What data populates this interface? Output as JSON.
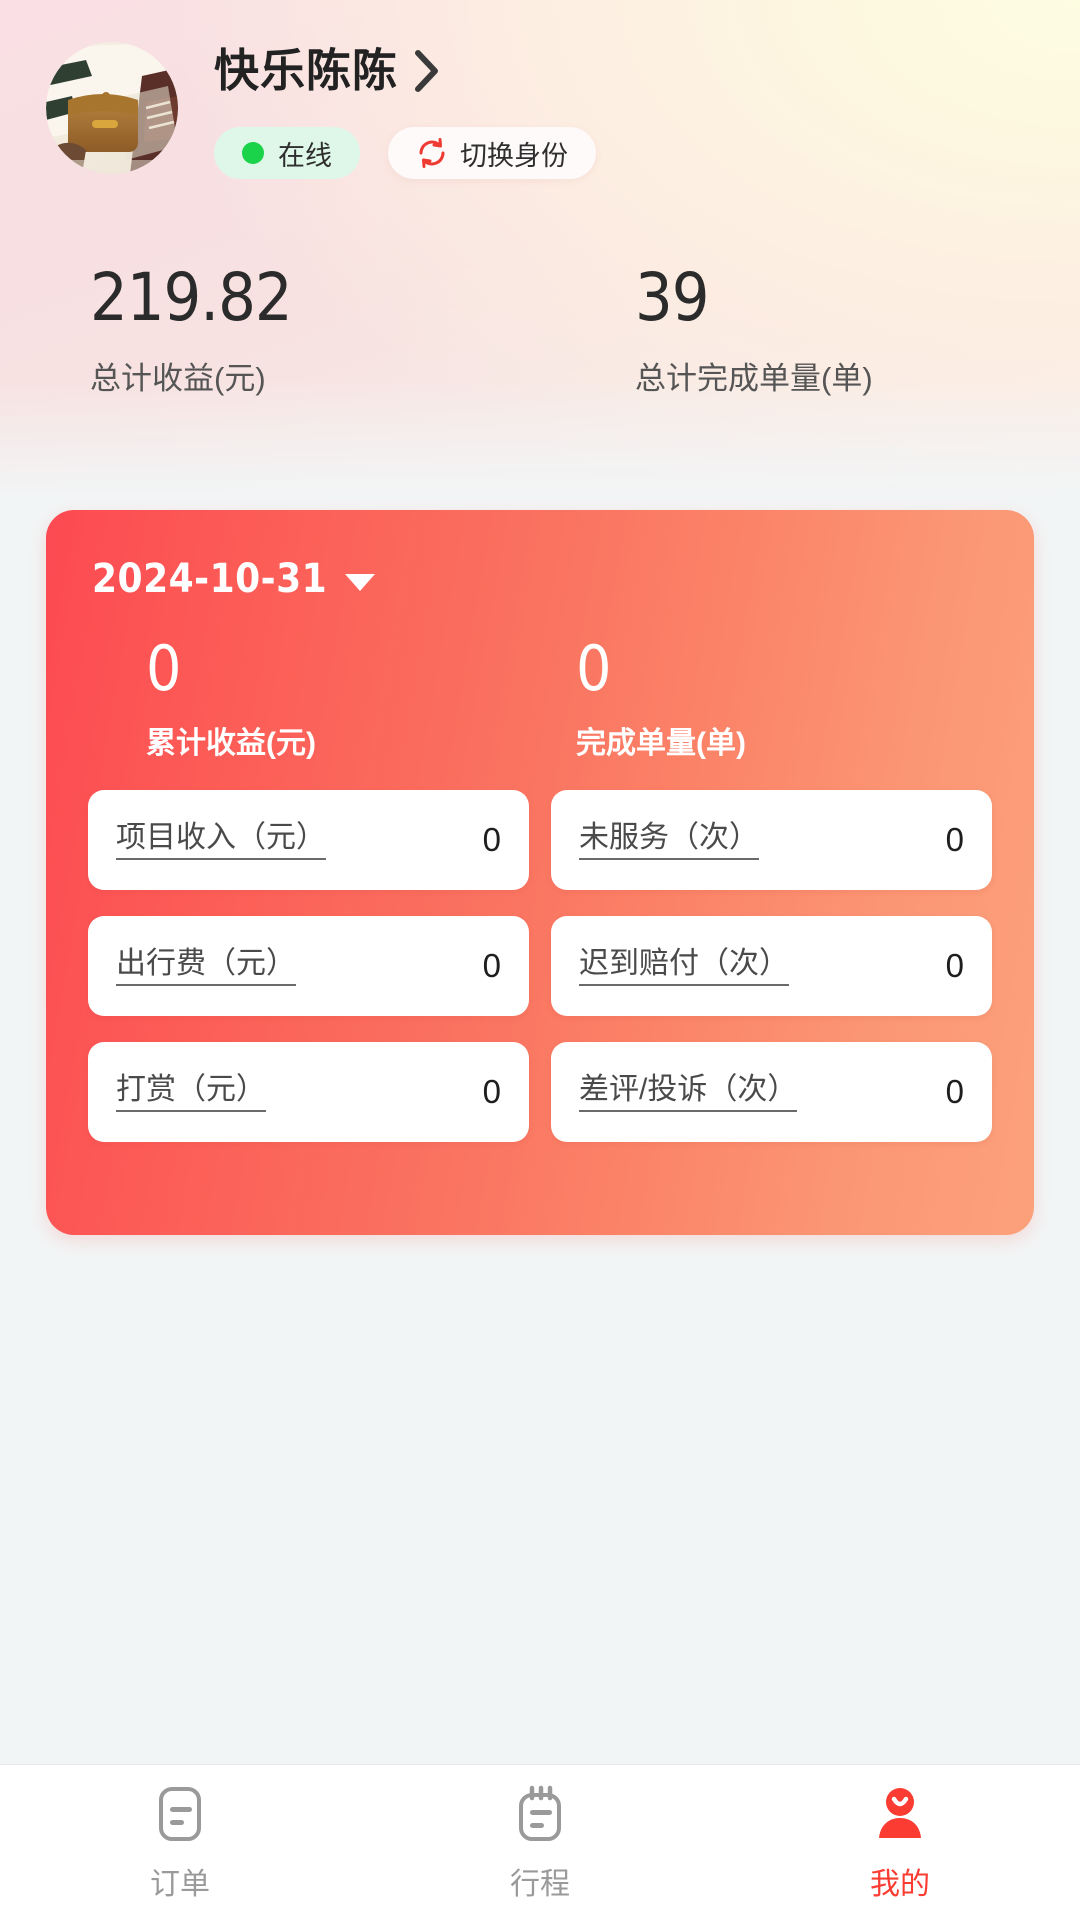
{
  "theme": {
    "page_bg": "#f2f5f6",
    "card_gradient_from": "#fc4a52",
    "card_gradient_to": "#fca17c",
    "accent_red": "#fa3c32",
    "online_green": "#1bd34a",
    "online_pill_bg": "#dff7e8"
  },
  "profile": {
    "name": "快乐陈陈",
    "avatar_alt": "brown-leather-bag-and-sneakers-photo",
    "chevron": "chevron-right-icon",
    "online_status": "在线",
    "switch_identity": "切换身份",
    "switch_icon": "swap-circle-icon"
  },
  "top_stats": [
    {
      "value": "219.82",
      "label": "总计收益(元)"
    },
    {
      "value": "39",
      "label": "总计完成单量(单)"
    }
  ],
  "earnings_card": {
    "date": "2024-10-31",
    "date_caret": "caret-down-icon",
    "summary": [
      {
        "value": "0",
        "label": "累计收益(元)"
      },
      {
        "value": "0",
        "label": "完成单量(单)"
      }
    ],
    "tiles": [
      {
        "label": "项目收入（元）",
        "value": "0"
      },
      {
        "label": "未服务（次）",
        "value": "0"
      },
      {
        "label": "出行费（元）",
        "value": "0"
      },
      {
        "label": "迟到赔付（次）",
        "value": "0"
      },
      {
        "label": "打赏（元）",
        "value": "0"
      },
      {
        "label": "差评/投诉（次）",
        "value": "0"
      }
    ]
  },
  "tabbar": {
    "items": [
      {
        "label": "订单",
        "icon": "order-document-icon",
        "active": false
      },
      {
        "label": "行程",
        "icon": "calendar-trip-icon",
        "active": false
      },
      {
        "label": "我的",
        "icon": "person-profile-icon",
        "active": true
      }
    ]
  }
}
